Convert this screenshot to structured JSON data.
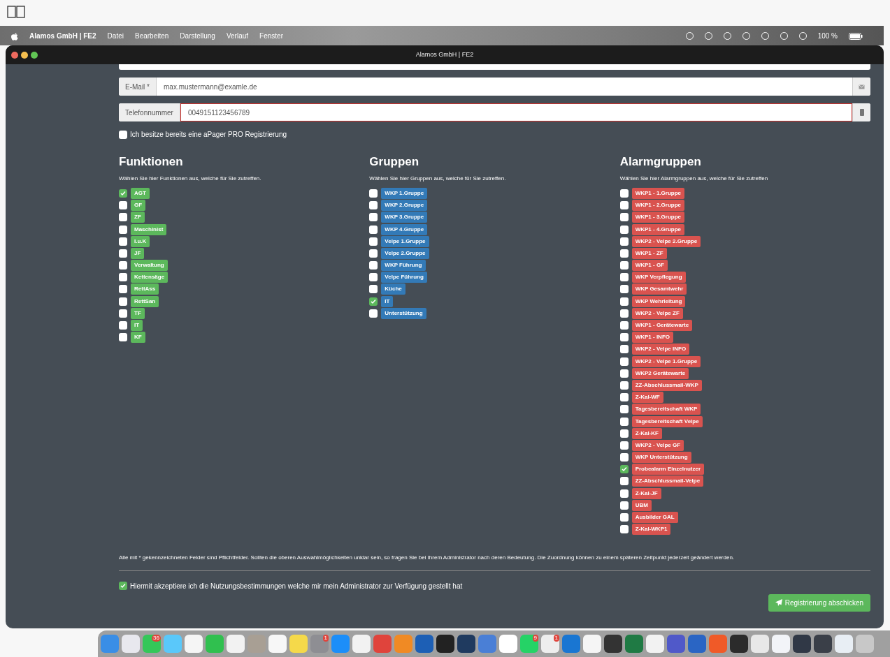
{
  "menu_bar": {
    "app": "Alamos GmbH | FE2",
    "items": [
      "Datei",
      "Bearbeiten",
      "Darstellung",
      "Verlauf",
      "Fenster"
    ],
    "battery": "100 %"
  },
  "window": {
    "title": "Alamos GmbH | FE2"
  },
  "form": {
    "fields": [
      {
        "label": "E-Mail *",
        "value": "max.mustermann@examle.de",
        "invalid": false,
        "kind": "email"
      },
      {
        "label": "Telefonnummer",
        "value": "0049151123456789",
        "invalid": true,
        "kind": "phone"
      }
    ],
    "pro_checkbox": {
      "label": "Ich besitze bereits eine aPager PRO Registrierung",
      "checked": false
    },
    "sections": [
      {
        "title": "Funktionen",
        "description": "Wählen Sie hier Funktionen aus, welche für Sie zutreffen.",
        "color": "#5cb85c",
        "items": [
          {
            "label": "AGT",
            "checked": true
          },
          {
            "label": "GF",
            "checked": false
          },
          {
            "label": "ZF",
            "checked": false
          },
          {
            "label": "Maschinist",
            "checked": false
          },
          {
            "label": "I.u.K",
            "checked": false
          },
          {
            "label": "JF",
            "checked": false
          },
          {
            "label": "Verwaltung",
            "checked": false
          },
          {
            "label": "Kettensäge",
            "checked": false
          },
          {
            "label": "RettAss",
            "checked": false
          },
          {
            "label": "RettSan",
            "checked": false
          },
          {
            "label": "TF",
            "checked": false
          },
          {
            "label": "IT",
            "checked": false
          },
          {
            "label": "KF",
            "checked": false
          }
        ]
      },
      {
        "title": "Gruppen",
        "description": "Wählen Sie hier Gruppen aus, welche für Sie zutreffen.",
        "color": "#337ab7",
        "items": [
          {
            "label": "WKP 1.Gruppe",
            "checked": false
          },
          {
            "label": "WKP 2.Gruppe",
            "checked": false
          },
          {
            "label": "WKP 3.Gruppe",
            "checked": false
          },
          {
            "label": "WKP 4.Gruppe",
            "checked": false
          },
          {
            "label": "Velpe 1.Gruppe",
            "checked": false
          },
          {
            "label": "Velpe 2.Gruppe",
            "checked": false
          },
          {
            "label": "WKP Führung",
            "checked": false
          },
          {
            "label": "Velpe Führung",
            "checked": false
          },
          {
            "label": "Küche",
            "checked": false
          },
          {
            "label": "IT",
            "checked": true
          },
          {
            "label": "Unterstützung",
            "checked": false
          }
        ]
      },
      {
        "title": "Alarmgruppen",
        "description": "Wählen Sie hier Alarmgruppen aus, welche für Sie zutreffen",
        "color": "#d9534f",
        "items": [
          {
            "label": "WKP1 - 1.Gruppe",
            "checked": false
          },
          {
            "label": "WKP1 - 2.Gruppe",
            "checked": false
          },
          {
            "label": "WKP1 - 3.Gruppe",
            "checked": false
          },
          {
            "label": "WKP1 - 4.Gruppe",
            "checked": false
          },
          {
            "label": "WKP2 - Velpe 2.Gruppe",
            "checked": false
          },
          {
            "label": "WKP1 - ZF",
            "checked": false
          },
          {
            "label": "WKP1 - GF",
            "checked": false
          },
          {
            "label": "WKP Verpflegung",
            "checked": false
          },
          {
            "label": "WKP Gesamtwehr",
            "checked": false
          },
          {
            "label": "WKP Wehrleitung",
            "checked": false
          },
          {
            "label": "WKP2 - Velpe ZF",
            "checked": false
          },
          {
            "label": "WKP1 - Gerätewarte",
            "checked": false
          },
          {
            "label": "WKP1 - INFO",
            "checked": false
          },
          {
            "label": "WKP2 - Velpe INFO",
            "checked": false
          },
          {
            "label": "WKP2 - Velpe 1.Gruppe",
            "checked": false
          },
          {
            "label": "WKP2 Gerätewarte",
            "checked": false
          },
          {
            "label": "ZZ-Abschlussmail-WKP",
            "checked": false
          },
          {
            "label": "Z-Kal-WF",
            "checked": false
          },
          {
            "label": "Tagesbereitschaft WKP",
            "checked": false
          },
          {
            "label": "Tagesbereitschaft Velpe",
            "checked": false
          },
          {
            "label": "Z-Kal-KF",
            "checked": false
          },
          {
            "label": "WKP2 - Velpe GF",
            "checked": false
          },
          {
            "label": "WKP Unterstützung",
            "checked": false
          },
          {
            "label": "Probealarm Einzelnutzer",
            "checked": true
          },
          {
            "label": "ZZ-Abschlussmail-Velpe",
            "checked": false
          },
          {
            "label": "Z-Kal-JF",
            "checked": false
          },
          {
            "label": "UBM",
            "checked": false
          },
          {
            "label": "Ausbilder GAL",
            "checked": false
          },
          {
            "label": "Z-Kal-WKP1",
            "checked": false
          }
        ]
      }
    ],
    "note": "Alle mit * gekennzeichneten Felder sind Pflichtfelder. Sollten die oberen Auswahlmöglichkeiten unklar sein, so fragen Sie bei Ihrem Administrator nach deren Bedeutung. Die Zuordnung können zu einem späteren Zeitpunkt jederzeit geändert werden.",
    "terms": {
      "label": "Hiermit akzeptiere ich die Nutzungsbestimmungen welche mir mein Administrator zur Verfügung gestellt hat",
      "checked": true
    },
    "submit": "Registrierung abschicken"
  },
  "dock": [
    {
      "color": "#3a8ee6"
    },
    {
      "color": "#e8e8ee"
    },
    {
      "color": "#34c759",
      "badge": "36"
    },
    {
      "color": "#5ac8fa"
    },
    {
      "color": "#f5f5f5"
    },
    {
      "color": "#30c04f"
    },
    {
      "color": "#f2f2f2"
    },
    {
      "color": "#a89f94"
    },
    {
      "color": "#f7f7f7"
    },
    {
      "color": "#f5d94a"
    },
    {
      "color": "#8e8e93",
      "badge": "1"
    },
    {
      "color": "#1c8ef9"
    },
    {
      "color": "#f2f2f2"
    },
    {
      "color": "#e0443c"
    },
    {
      "color": "#f08a24"
    },
    {
      "color": "#1d5fb5"
    },
    {
      "color": "#222222"
    },
    {
      "color": "#1f3a5f"
    },
    {
      "color": "#4a7fd6"
    },
    {
      "color": "#ffffff"
    },
    {
      "color": "#25d366",
      "badge": "9"
    },
    {
      "color": "#eeeeee",
      "badge": "1"
    },
    {
      "color": "#1976d2"
    },
    {
      "color": "#f5f5f5"
    },
    {
      "color": "#333333"
    },
    {
      "color": "#1f7a44"
    },
    {
      "color": "#f2f2f2"
    },
    {
      "color": "#5059c9"
    },
    {
      "color": "#2a65c4"
    },
    {
      "color": "#f05a28"
    },
    {
      "color": "#2b2b2b"
    },
    {
      "color": "#e8e8e8"
    },
    {
      "color": "#f2f4f8"
    },
    {
      "color": "#303846"
    },
    {
      "color": "#3a3f48"
    },
    {
      "color": "#e8eef4"
    },
    {
      "color": "#c8c8c8"
    }
  ]
}
